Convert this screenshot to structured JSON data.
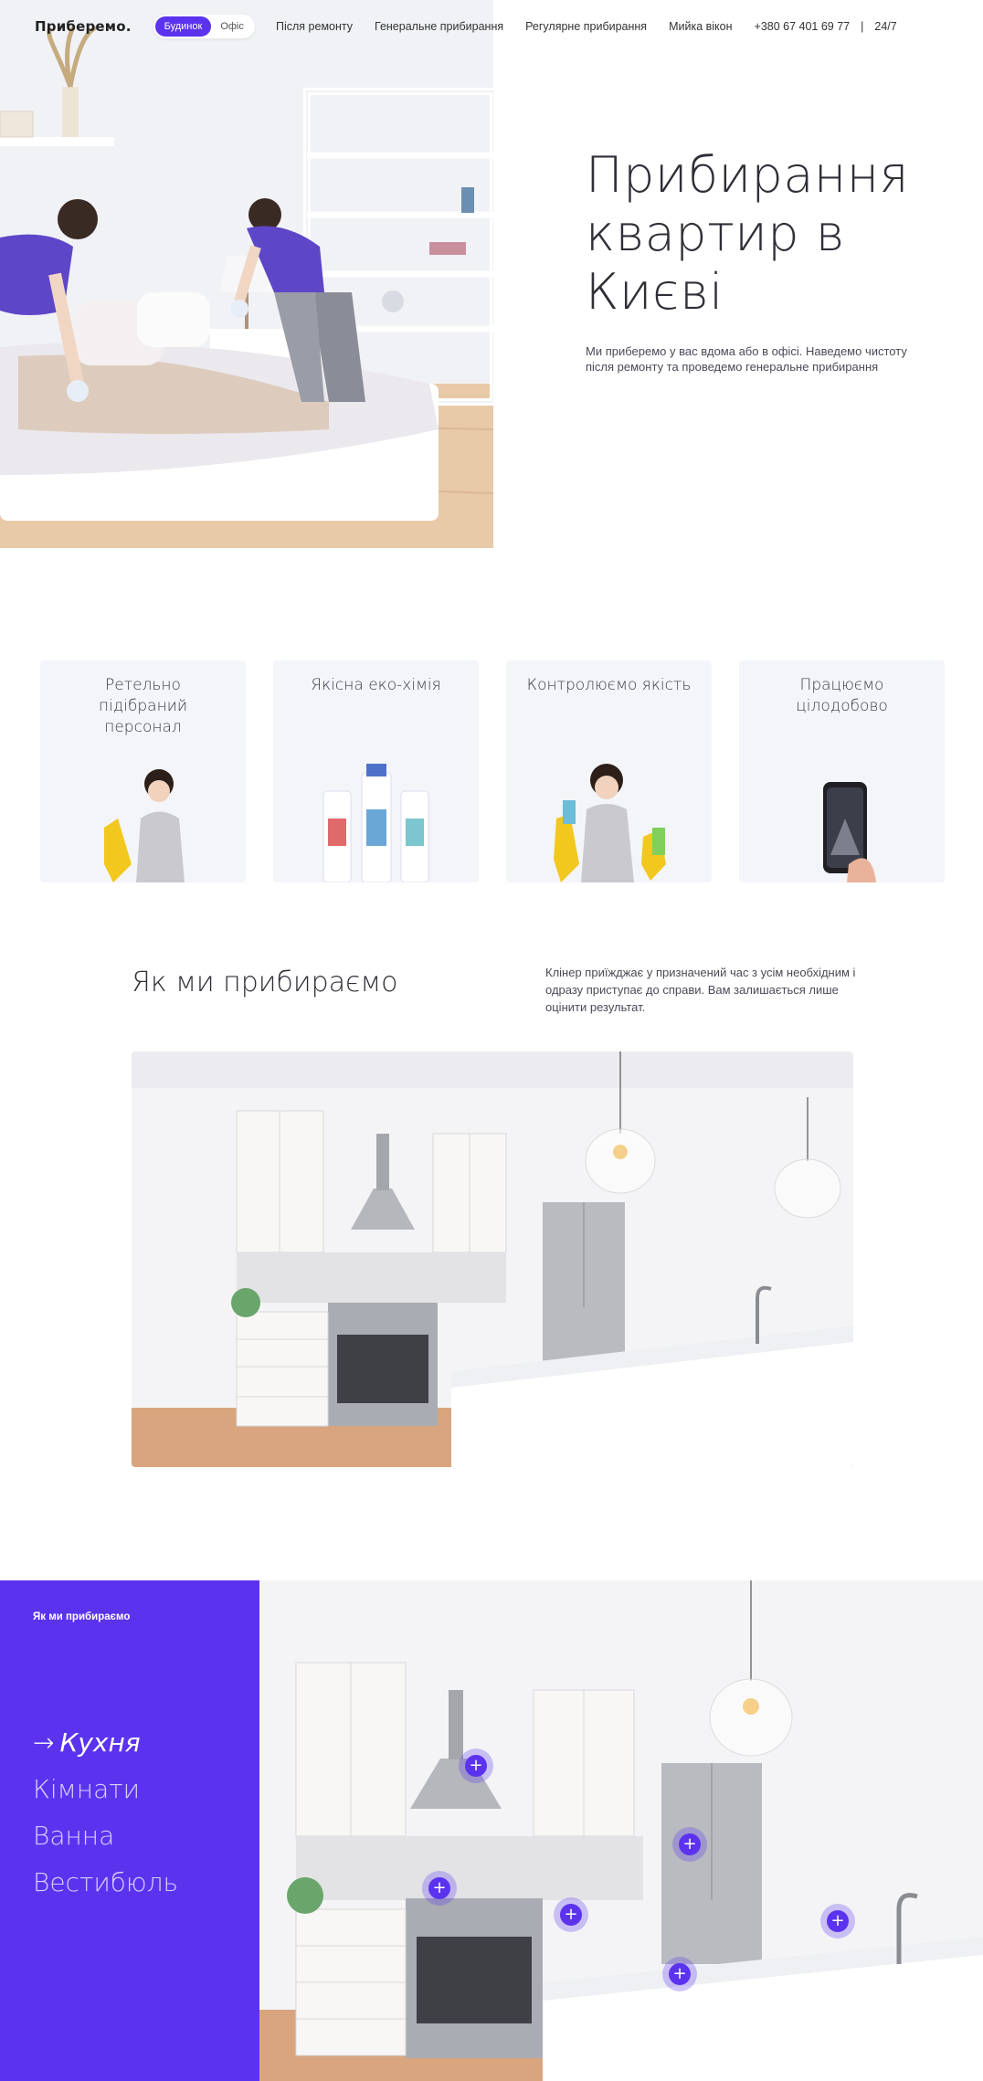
{
  "header": {
    "logo": "Приберемо.",
    "segment": {
      "home": "Будинок",
      "office": "Офіс",
      "active": "home"
    },
    "nav": [
      "Після ремонту",
      "Генеральне прибирання",
      "Регулярне прибирання",
      "Мийка вікон"
    ],
    "phone": "+380 67 401 69 77",
    "separator": "|",
    "hours": "24/7"
  },
  "hero": {
    "title": "Прибирання квартир в Києві",
    "description": "Ми приберемо у вас вдома або в офісі. Наведемо чистоту після ремонту та проведемо генеральне прибирання"
  },
  "features": [
    {
      "title": "Ретельно підібраний персонал",
      "icon": "woman-with-gloves"
    },
    {
      "title": "Якісна еко-хімія",
      "icon": "cleaning-bottles"
    },
    {
      "title": "Контролюємо якість",
      "icon": "smiling-cleaner"
    },
    {
      "title": "Працюємо цілодобово",
      "icon": "smartphone"
    }
  ],
  "how": {
    "title": "Як ми прибираємо",
    "description": "Клінер приїжджає у призначений час з усім необхідним і одразу приступає до справи. Вам залишається лише оцінити результат."
  },
  "interactive": {
    "label": "Як ми прибираємо",
    "arrow": "→",
    "rooms": [
      "Кухня",
      "Кімнати",
      "Ванна",
      "Вестибюль"
    ],
    "active_room": "Кухня",
    "hotspot_symbol": "+"
  },
  "colors": {
    "accent": "#5b33ef",
    "card_bg": "#f3f5f9",
    "text": "#2f2f37"
  }
}
